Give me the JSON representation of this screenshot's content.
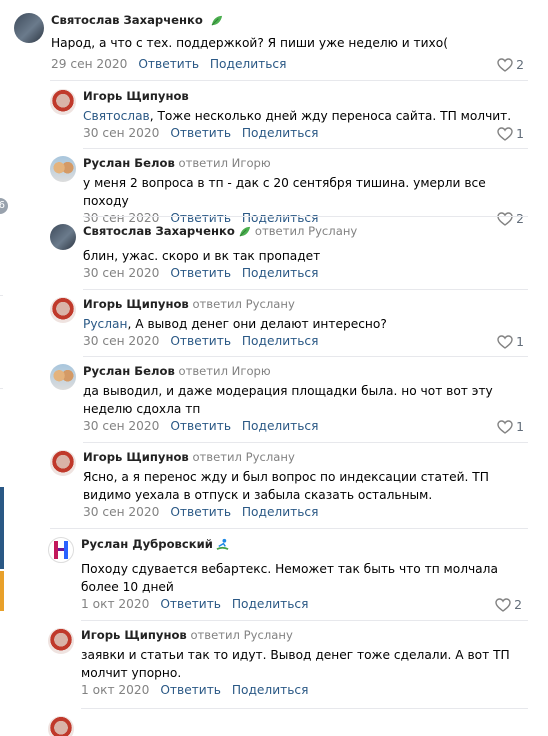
{
  "edge": {
    "badge": "6"
  },
  "labels": {
    "reply_action": "Ответить",
    "share_action": "Поделиться"
  },
  "icons": {
    "like": "heart-icon",
    "author_badge": "leaf-icon",
    "author_badge_alt": "surfer-icon"
  },
  "colors": {
    "link": "#2a5885",
    "muted": "#828282",
    "heart": "#828282",
    "separator": "#e7e8ec"
  },
  "comments": [
    {
      "author": "Святослав Захарченко",
      "reply_to": "",
      "mention": "",
      "text": "Народ, а что с тех. поддержкой? Я пиши уже неделю и тихо(",
      "date": "29 сен 2020",
      "likes": "2"
    },
    {
      "author": "Игорь Щипунов",
      "reply_to": "",
      "mention": "Святослав",
      "text": ", Тоже несколько дней жду переноса сайта. ТП молчит.",
      "date": "30 сен 2020",
      "likes": "1"
    },
    {
      "author": "Руслан Белов",
      "reply_to": "ответил Игорю",
      "mention": "",
      "text": "у меня 2 вопроса в тп - дак с 20 сентября тишина. умерли все походу",
      "date": "30 сен 2020",
      "likes": "2"
    },
    {
      "author": "Святослав Захарченко",
      "reply_to": "ответил Руслану",
      "mention": "",
      "text": "блин, ужас. скоро и вк так пропадет",
      "date": "30 сен 2020",
      "likes": ""
    },
    {
      "author": "Игорь Щипунов",
      "reply_to": "ответил Руслану",
      "mention": "Руслан",
      "text": ", А вывод денег они делают интересно?",
      "date": "30 сен 2020",
      "likes": "1"
    },
    {
      "author": "Руслан Белов",
      "reply_to": "ответил Игорю",
      "mention": "",
      "text": "да выводил, и даже модерация площадки была. но чот вот эту неделю сдохла тп",
      "date": "30 сен 2020",
      "likes": "1"
    },
    {
      "author": "Игорь Щипунов",
      "reply_to": "ответил Руслану",
      "mention": "",
      "text": "Ясно, а я перенос жду и был вопрос по индексации статей. ТП видимо уехала в отпуск и забыла сказать остальным.",
      "date": "30 сен 2020",
      "likes": ""
    },
    {
      "author": "Руслан Дубровский",
      "reply_to": "",
      "mention": "",
      "text": "Походу сдувается вебартекс. Неможет так быть что тп молчала более 10 дней",
      "date": "1 окт 2020",
      "likes": "2"
    },
    {
      "author": "Игорь Щипунов",
      "reply_to": "ответил Руслану",
      "mention": "",
      "text": "заявки и статьи так то идут. Вывод денег тоже сделали. А вот ТП молчит упорно.",
      "date": "1 окт 2020",
      "likes": ""
    }
  ]
}
